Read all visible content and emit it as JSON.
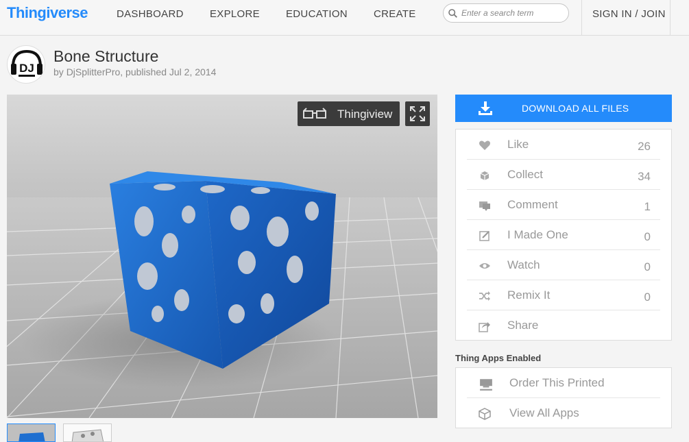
{
  "nav": {
    "logo": "Thingiverse",
    "items": [
      "DASHBOARD",
      "EXPLORE",
      "EDUCATION",
      "CREATE"
    ],
    "search_placeholder": "Enter a search term",
    "signin": "SIGN IN / JOIN"
  },
  "thing": {
    "title": "Bone Structure",
    "byline_prefix": "by ",
    "author": "DjSplitterPro",
    "byline_suffix": ", published Jul 2, 2014",
    "avatar_text": "DJ"
  },
  "viewer": {
    "thingiview_label": "Thingiview"
  },
  "actions": {
    "download_label": "DOWNLOAD ALL FILES",
    "stats": [
      {
        "label": "Like",
        "count": "26",
        "icon": "heart-icon"
      },
      {
        "label": "Collect",
        "count": "34",
        "icon": "collect-icon"
      },
      {
        "label": "Comment",
        "count": "1",
        "icon": "comment-icon"
      },
      {
        "label": "I Made One",
        "count": "0",
        "icon": "made-icon"
      },
      {
        "label": "Watch",
        "count": "0",
        "icon": "eye-icon"
      },
      {
        "label": "Remix It",
        "count": "0",
        "icon": "remix-icon"
      },
      {
        "label": "Share",
        "count": "",
        "icon": "share-icon"
      }
    ]
  },
  "apps": {
    "heading": "Thing Apps Enabled",
    "items": [
      {
        "label": "Order This Printed",
        "icon": "printer-icon"
      },
      {
        "label": "View All Apps",
        "icon": "cube-icon"
      }
    ]
  },
  "colors": {
    "brand": "#248bfb",
    "model": "#1f6fd0"
  }
}
